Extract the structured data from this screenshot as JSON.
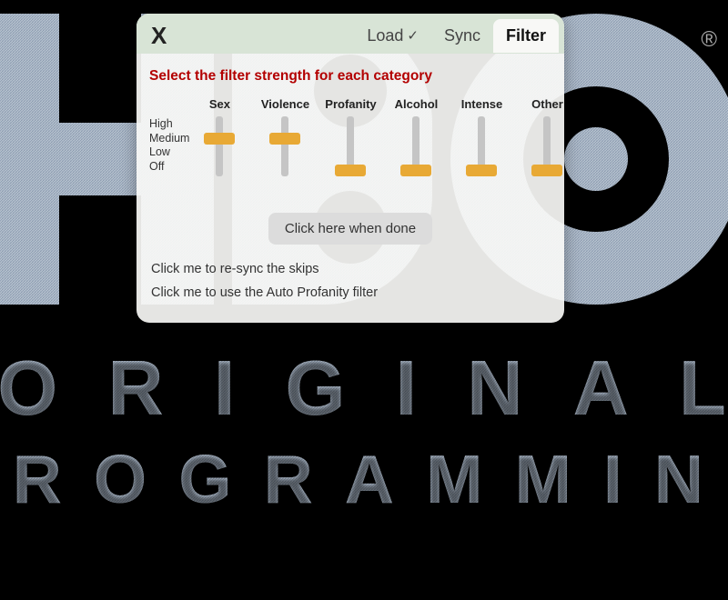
{
  "background": {
    "logo_letters": [
      "H",
      "B",
      "O"
    ],
    "registered_mark": "®",
    "subtitle_line1": "ORIGINAL",
    "subtitle_line2": "PROGRAMMING"
  },
  "panel": {
    "close_label": "X",
    "tabs": [
      {
        "label": "Load",
        "checked": true,
        "active": false
      },
      {
        "label": "Sync",
        "checked": false,
        "active": false
      },
      {
        "label": "Filter",
        "checked": false,
        "active": true
      }
    ],
    "instruction": "Select the filter strength for each category",
    "levels": [
      "High",
      "Medium",
      "Low",
      "Off"
    ],
    "categories": [
      {
        "name": "Sex",
        "value": "Medium",
        "posIndex": 1
      },
      {
        "name": "Violence",
        "value": "Medium",
        "posIndex": 1
      },
      {
        "name": "Profanity",
        "value": "Off",
        "posIndex": 3
      },
      {
        "name": "Alcohol",
        "value": "Off",
        "posIndex": 3
      },
      {
        "name": "Intense",
        "value": "Off",
        "posIndex": 3
      },
      {
        "name": "Other",
        "value": "Off",
        "posIndex": 3
      }
    ],
    "done_label": "Click here when done",
    "resync_label": "Click me to re-sync the skips",
    "autoprofanity_label": "Click me to use the Auto Profanity filter"
  }
}
